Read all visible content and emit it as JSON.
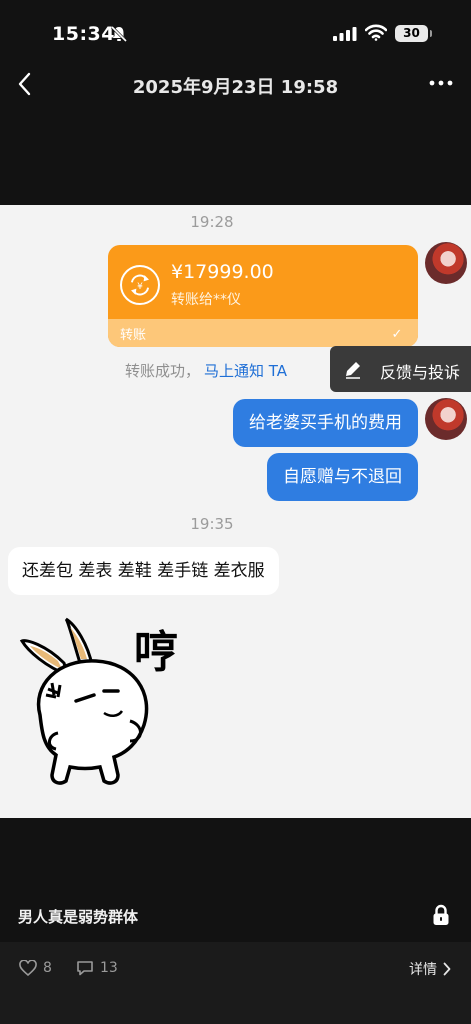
{
  "status_bar": {
    "time": "15:34",
    "battery": "30"
  },
  "header": {
    "title": "2025年9月23日 19:58"
  },
  "chat": {
    "time_1": "19:28",
    "transfer": {
      "amount": "¥17999.00",
      "recipient": "转账给**仪",
      "label": "转账"
    },
    "transfer_status": "转账成功，",
    "notify_link": "马上通知 TA",
    "feedback": "反馈与投诉",
    "message_1": "给老婆买手机的费用",
    "message_2": "自愿赠与不退回",
    "time_2": "19:35",
    "reply": "还差包 差表 差鞋 差手链 差衣服",
    "sticker_text": "哼"
  },
  "caption": "男人真是弱势群体",
  "actions": {
    "likes": "8",
    "comments": "13",
    "details": "详情"
  }
}
